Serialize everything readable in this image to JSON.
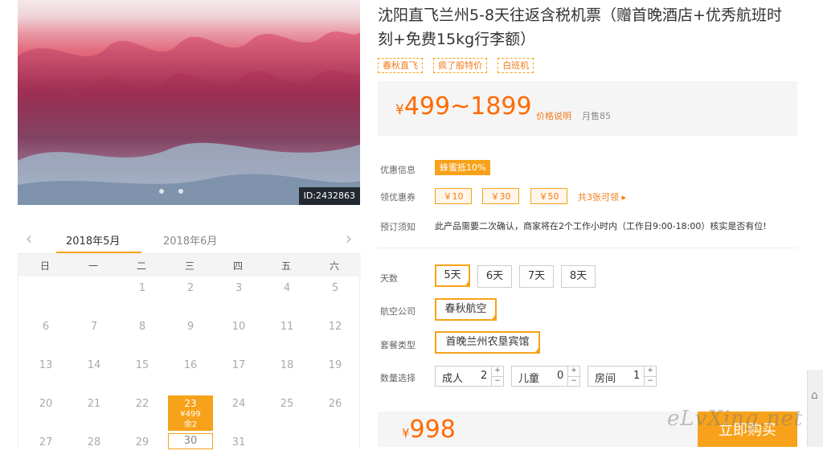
{
  "photo": {
    "id_badge": "ID:2432863"
  },
  "calendar": {
    "months": [
      "2018年5月",
      "2018年6月"
    ],
    "weekdays": [
      "日",
      "一",
      "二",
      "三",
      "四",
      "五",
      "六"
    ],
    "days": [
      "1",
      "2",
      "3",
      "4",
      "5",
      "6",
      "7",
      "8",
      "9",
      "10",
      "11",
      "12",
      "13",
      "14",
      "15",
      "16",
      "17",
      "18",
      "19",
      "20",
      "21",
      "22",
      "23",
      "24",
      "25",
      "26",
      "27",
      "28",
      "29",
      "30",
      "31"
    ],
    "selected": {
      "day": "23",
      "price": "¥499",
      "remain": "余2"
    }
  },
  "product": {
    "title": "沈阳直飞兰州5-8天往返含税机票（赠首晚酒店+优秀航班时刻+免费15kg行李额）",
    "tags": [
      "春秋直飞",
      "疯了般特价",
      "白班机"
    ],
    "price_symbol": "¥",
    "price_range": "499~1899",
    "price_note": "价格说明",
    "monthly_sales": "月售85"
  },
  "info": {
    "promo_label": "优惠信息",
    "promo_value": "蜂蜜抵10%",
    "coupon_label": "领优惠券",
    "coupons": [
      "￥10",
      "￥30",
      "￥50"
    ],
    "coupon_more": "共3张可领 ▸",
    "notice_label": "预订须知",
    "notice_text": "此产品需要二次确认，商家将在2个工作小时内（工作日9:00-18:00）核实是否有位!"
  },
  "options": {
    "days_label": "天数",
    "days": [
      "5天",
      "6天",
      "7天",
      "8天"
    ],
    "airline_label": "航空公司",
    "airline": "春秋航空",
    "package_label": "套餐类型",
    "package": "首晚兰州农垦宾馆",
    "qty_label": "数量选择",
    "qty": [
      {
        "name": "成人",
        "value": "2"
      },
      {
        "name": "儿童",
        "value": "0"
      },
      {
        "name": "房间",
        "value": "1"
      }
    ],
    "plus": "+",
    "minus": "−"
  },
  "buy": {
    "price_symbol": "¥",
    "total": "998",
    "button": "立即购买",
    "watermark": "eLvXing.net"
  },
  "colors": {
    "accent": "#f7a21a",
    "price": "#ff6a00"
  }
}
